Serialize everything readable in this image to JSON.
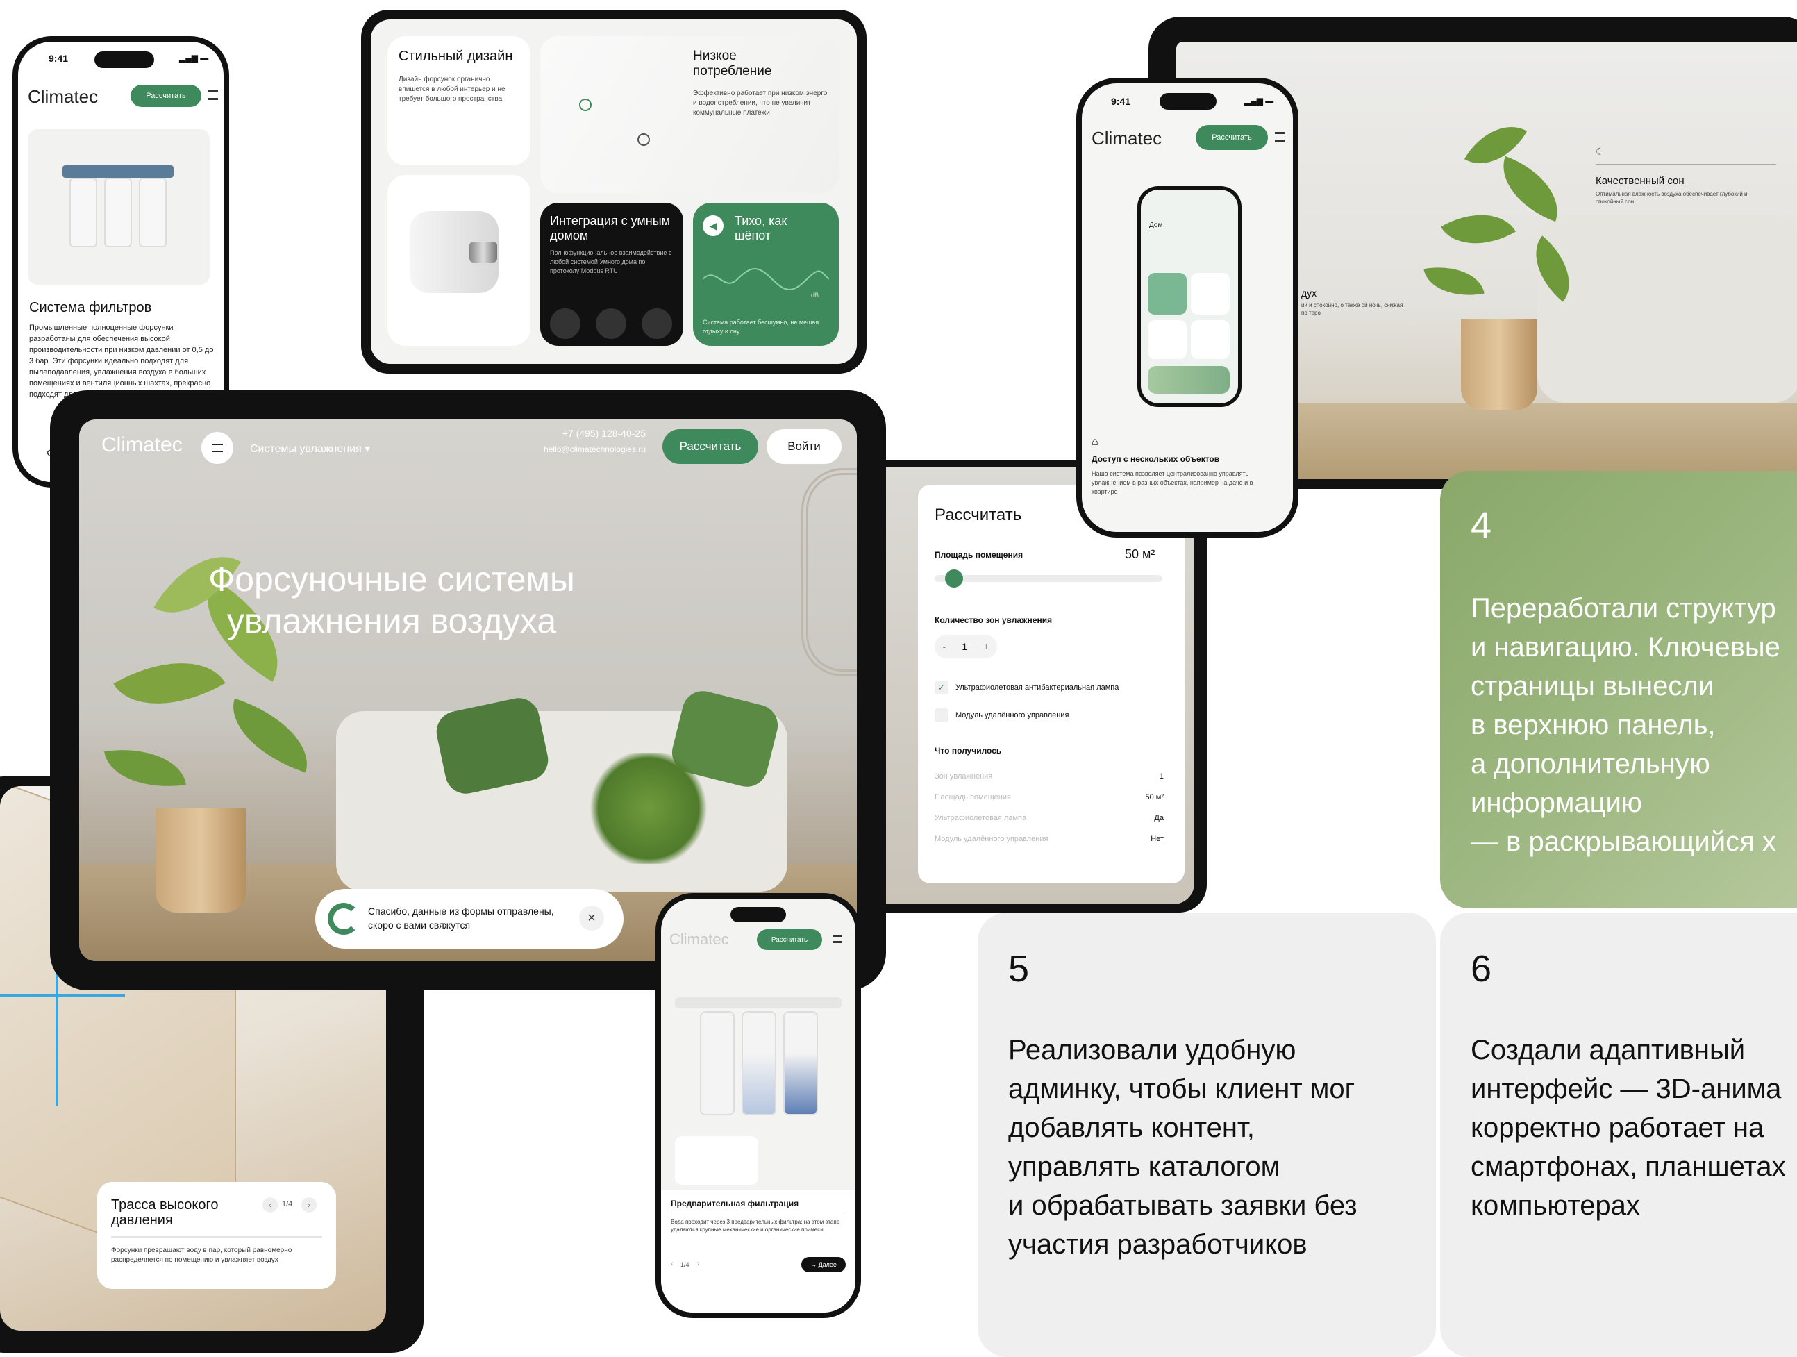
{
  "brand": {
    "name": "Climatec",
    "accent": "#3f8a5c"
  },
  "phone_filters": {
    "time": "9:41",
    "cta": "Рассчитать",
    "title": "Система фильтров",
    "body": "Промышленные полноценные форсунки разработаны для обеспечения высокой производительности при низком давлении от 0,5 до 3 бар. Эти форсунки идеально подходят для пылеподавления, увлажнения воздуха в больших помещениях и вентиляционных шахтах, прекрасно подходят для мобильных систем"
  },
  "tablet_features": {
    "card1_title": "Стильный дизайн",
    "card1_text": "Дизайн форсунок органично впишется в любой интерьер и не требует большого пространства",
    "card2_title": "Низкое потребление",
    "card2_text": "Эффективно работает при низком энерго и водопотреблении, что не увеличит коммунальные платежи",
    "card3_title": "Интеграция с умным домом",
    "card3_text": "Полнофункциональное взаимодействие с любой системой Умного дома по протоколу Modbus RTU",
    "card4_title": "Тихо, как шёпот",
    "card4_value": "dB",
    "card4_text": "Система работает бесшумно, не мешая отдыху и сну"
  },
  "phone_smart": {
    "time": "9:41",
    "cta": "Рассчитать",
    "inner_home": "Дом",
    "title": "Доступ с нескольких объектов",
    "body": "Наша система позволяет централизованно управлять увлажнением в разных объектах, например на даче и в квартире"
  },
  "tablet_room": {
    "title": "Качественный сон",
    "body": "Оптимальная влажность воздуха обеспечивает глубокий и спокойный сон",
    "partial_title": "дух",
    "partial_body": "ий и спокойно, о также ой ночь, снижая по теро"
  },
  "panel4": {
    "number": "4",
    "text": "Переработали структур и навигацию. Ключевые страницы вынесли в верхнюю панель, а дополнительную информацию — в раскрывающийся х",
    "lines": [
      "Переработали структур",
      "и навигацию. Ключевые",
      "страницы вынесли",
      "в верхнюю панель,",
      "а дополнительную",
      "информацию",
      "— в раскрывающийся х"
    ]
  },
  "panel5": {
    "number": "5",
    "lines": [
      "Реализовали удобную",
      "админку, чтобы клиент мог",
      "добавлять контент,",
      "управлять каталогом",
      "и обрабатывать заявки без",
      "участия разработчиков"
    ]
  },
  "panel6": {
    "number": "6",
    "lines": [
      "Создали адаптивный",
      "интерфейс — 3D-анима",
      "корректно работает на",
      "смартфонах, планшетах",
      "компьютерах"
    ]
  },
  "tablet_main": {
    "nav_link": "Системы увлажнения",
    "phone": "+7 (495) 128-40-25",
    "email": "hello@climatechnologies.ru",
    "cta": "Рассчитать",
    "login": "Войти",
    "hero_line1": "Форсуночные системы",
    "hero_line2": "увлажнения воздуха",
    "toast": "Спасибо, данные из формы отправлены, скоро с вами свяжутся",
    "toast_close": "×"
  },
  "calc": {
    "title": "Рассчитать",
    "area_label": "Площадь помещения",
    "area_value": "50 м²",
    "area_slider": 0.05,
    "zones_label": "Количество зон увлажнения",
    "zones_minus": "-",
    "zones_value": "1",
    "zones_plus": "+",
    "opt1": "Ультрафиолетовая антибактериальная лампа",
    "opt1_checked": true,
    "opt2": "Модуль удалённого управления",
    "opt2_checked": false,
    "result_title": "Что получилось",
    "rows": [
      {
        "label": "Зон увлажнения",
        "value": "1"
      },
      {
        "label": "Площадь помещения",
        "value": "50 м²"
      },
      {
        "label": "Ультрафиолетовая лампа",
        "value": "Да"
      },
      {
        "label": "Модуль удалённого управления",
        "value": "Нет"
      }
    ]
  },
  "tablet_house": {
    "title_line1": "Трасса высокого",
    "title_line2": "давления",
    "pager": "1/4",
    "body": "Форсунки превращают воду в пар, который равномерно распределяется по помещению и увлажняет воздух"
  },
  "phone_filter2": {
    "cta": "Рассчитать",
    "label": "Предварительная фильтрация",
    "body": "Вода проходит через 3 предварительных фильтра: на этом этапе удаляются крупные механические и органические примеси",
    "pager": "1/4",
    "next": "Далее"
  }
}
